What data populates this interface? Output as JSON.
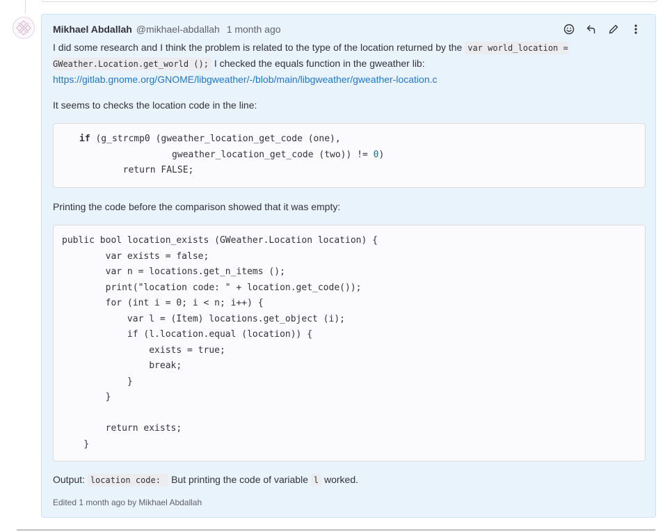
{
  "note": {
    "author_name": "Mikhael Abdallah",
    "author_handle": "@mikhael-abdallah",
    "time": "1 month ago",
    "para1_prefix": "I did some research and I think the problem is related to the type of the location returned by the",
    "para1_code": "var world_location = GWeather.Location.get_world ();",
    "para1_suffix": "I checked the equals function in the gweather lib:",
    "link_text": "https://gitlab.gnome.org/GNOME/libgweather/-/blob/main/libgweather/gweather-location.c",
    "para2": "It seems to checks the location code in the line:",
    "code1": {
      "line1_kw": "if",
      "line1_rest": " (g_strcmp0 (gweather_location_get_code (one),",
      "line2_a": "                 gweather_location_get_code (two)) != ",
      "line2_num": "0",
      "line2_b": ")",
      "line3": "        return FALSE;"
    },
    "para3": "Printing the code before the comparison showed that it was empty:",
    "code2": "public bool location_exists (GWeather.Location location) {\n        var exists = false;\n        var n = locations.get_n_items ();\n        print(\"location code: \" + location.get_code());\n        for (int i = 0; i < n; i++) {\n            var l = (Item) locations.get_object (i);\n            if (l.location.equal (location)) {\n                exists = true;\n                break;\n            }\n        }\n\n        return exists;\n    }",
    "output_label": "Output:",
    "output_code": "location code: ",
    "output_mid": "But printing the code of variable",
    "output_var": "l",
    "output_end": "worked.",
    "edited": "Edited 1 month ago by Mikhael Abdallah"
  },
  "icons": [
    "emoji-icon",
    "reply-icon",
    "edit-pencil-icon",
    "more-actions-icon"
  ]
}
